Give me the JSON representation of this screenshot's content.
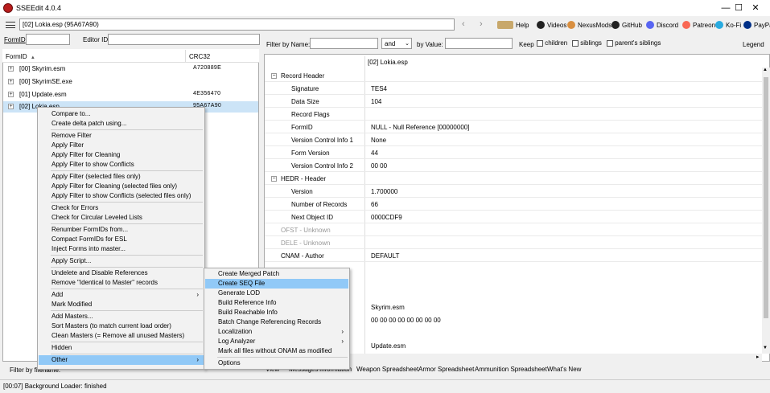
{
  "window": {
    "title": "SSEEdit 4.0.4",
    "minimize": "—",
    "maximize": "☐",
    "close": "✕"
  },
  "toolbar": {
    "path": "[02] Lokia.esp (95A67A90)",
    "back": "‹",
    "forward": "›",
    "links": [
      {
        "label": "Help",
        "color": "#8a6d3b"
      },
      {
        "label": "Videos",
        "color": "#222222"
      },
      {
        "label": "NexusMods",
        "color": "#d98f40"
      },
      {
        "label": "GitHub",
        "color": "#222222"
      },
      {
        "label": "Discord",
        "color": "#5865f2"
      },
      {
        "label": "Patreon",
        "color": "#f96854"
      },
      {
        "label": "Ko-Fi",
        "color": "#29abe0"
      },
      {
        "label": "PayPal",
        "color": "#003087"
      }
    ]
  },
  "left_filter": {
    "formid_label": "FormID",
    "editorid_label": "Editor ID"
  },
  "tree": {
    "col_formid": "FormID",
    "col_crc": "CRC32",
    "sort_arrow": "▲",
    "rows": [
      {
        "name": "[00] Skyrim.esm",
        "crc": "A720889E"
      },
      {
        "name": "[00] SkyrimSE.exe",
        "crc": ""
      },
      {
        "name": "[01] Update.esm",
        "crc": "4E356470"
      },
      {
        "name": "[02] Lokia.esp",
        "crc": "95A67A90"
      }
    ]
  },
  "right_filter": {
    "name_label": "Filter by Name:",
    "and_value": "and",
    "value_label": "by Value:",
    "keep_label": "Keep",
    "children_label": "children",
    "siblings_label": "siblings",
    "parents_label": "parent's siblings",
    "legend_label": "Legend"
  },
  "record": {
    "column_header": "[02] Lokia.esp",
    "rows": [
      {
        "key": "Record Header",
        "value": "",
        "level": 0,
        "gray": false
      },
      {
        "key": "Signature",
        "value": "TES4",
        "level": 1,
        "gray": false
      },
      {
        "key": "Data Size",
        "value": "104",
        "level": 1,
        "gray": false
      },
      {
        "key": "Record Flags",
        "value": "",
        "level": 1,
        "gray": false
      },
      {
        "key": "FormID",
        "value": "NULL - Null Reference [00000000]",
        "level": 1,
        "gray": false
      },
      {
        "key": "Version Control Info 1",
        "value": "None",
        "level": 1,
        "gray": false
      },
      {
        "key": "Form Version",
        "value": "44",
        "level": 1,
        "gray": false
      },
      {
        "key": "Version Control Info 2",
        "value": "00 00",
        "level": 1,
        "gray": false
      },
      {
        "key": "HEDR - Header",
        "value": "",
        "level": 0,
        "gray": false
      },
      {
        "key": "Version",
        "value": "1.700000",
        "level": 1,
        "gray": false
      },
      {
        "key": "Number of Records",
        "value": "66",
        "level": 1,
        "gray": false
      },
      {
        "key": "Next Object ID",
        "value": "0000CDF9",
        "level": 1,
        "gray": false
      },
      {
        "key": "OFST - Unknown",
        "value": "",
        "level": -1,
        "gray": true
      },
      {
        "key": "DELE - Unknown",
        "value": "",
        "level": -1,
        "gray": true
      },
      {
        "key": "CNAM - Author",
        "value": "DEFAULT",
        "level": -1,
        "gray": false
      }
    ],
    "below_menu_values": [
      "Skyrim.esm",
      "00 00 00 00 00 00 00 00",
      "Update.esm"
    ]
  },
  "context_menu": {
    "items": [
      "Compare to...",
      "Create delta patch using...",
      "---",
      "Remove Filter",
      "Apply Filter",
      "Apply Filter for Cleaning",
      "Apply Filter to show Conflicts",
      "---",
      "Apply Filter (selected files only)",
      "Apply Filter for Cleaning (selected files only)",
      "Apply Filter to show Conflicts (selected files only)",
      "---",
      "Check for Errors",
      "Check for Circular Leveled Lists",
      "---",
      "Renumber FormIDs from...",
      "Compact FormIDs for ESL",
      "Inject Forms into master...",
      "---",
      "Apply Script...",
      "---",
      "Undelete and Disable References",
      "Remove \"Identical to Master\" records",
      "---",
      "Add",
      "Mark Modified",
      "---",
      "Add Masters...",
      "Sort Masters (to match current load order)",
      "Clean Masters (= Remove all unused Masters)",
      "---",
      "Hidden",
      "---",
      "Other"
    ],
    "submenu_arrow": "›"
  },
  "submenu": {
    "items": [
      "Create Merged Patch",
      "Create SEQ File",
      "Generate LOD",
      "Build Reference Info",
      "Build Reachable Info",
      "Batch Change Referencing Records",
      "Localization",
      "Log Analyzer",
      "Mark all files without ONAM as modified",
      "---",
      "Options"
    ]
  },
  "bottom": {
    "filter_label": "Filter by filename:",
    "tabs": [
      "View",
      "Messages",
      "Information",
      "Weapon Spreadsheet",
      "Armor Spreadsheet",
      "Ammunition Spreadsheet",
      "What's New"
    ]
  },
  "status": {
    "text": "[00:07] Background Loader: finished"
  }
}
